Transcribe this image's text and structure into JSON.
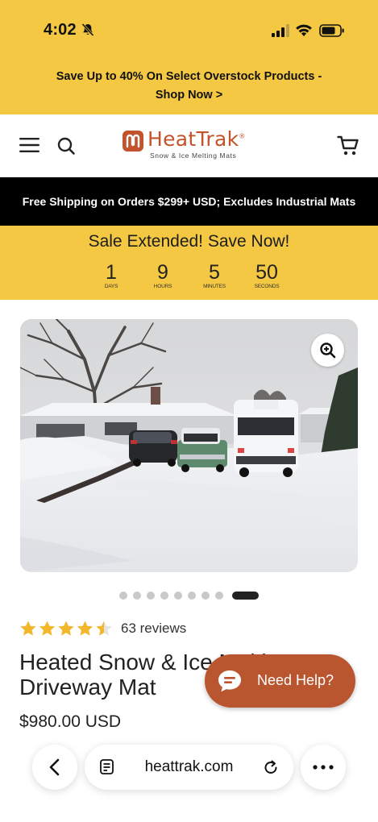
{
  "status_bar": {
    "time": "4:02"
  },
  "promo": {
    "line1": "Save Up to 40% On Select Overstock Products -",
    "line2": "Shop Now >"
  },
  "header": {
    "logo_text": "HeatTrak",
    "logo_trademark": "®",
    "logo_tagline": "Snow & Ice Melting Mats"
  },
  "shipping_banner": "Free Shipping on Orders $299+ USD; Excludes Industrial Mats",
  "sale": {
    "title": "Sale Extended! Save Now!",
    "countdown": [
      {
        "value": "1",
        "label": "DAYS"
      },
      {
        "value": "9",
        "label": "HOURS"
      },
      {
        "value": "5",
        "label": "MINUTES"
      },
      {
        "value": "50",
        "label": "SECONDS"
      }
    ]
  },
  "gallery": {
    "total_images": 9,
    "active_index": 8
  },
  "product": {
    "rating": 4.5,
    "reviews": "63 reviews",
    "title": "Heated Snow & Ice Melting Driveway Mat",
    "price": "$980.00 USD"
  },
  "help_button": "Need Help?",
  "browser": {
    "url": "heattrak.com"
  },
  "colors": {
    "yellow": "#F4C842",
    "brand": "#C2532C",
    "help": "#B9552F",
    "star": "#F2B72A"
  }
}
